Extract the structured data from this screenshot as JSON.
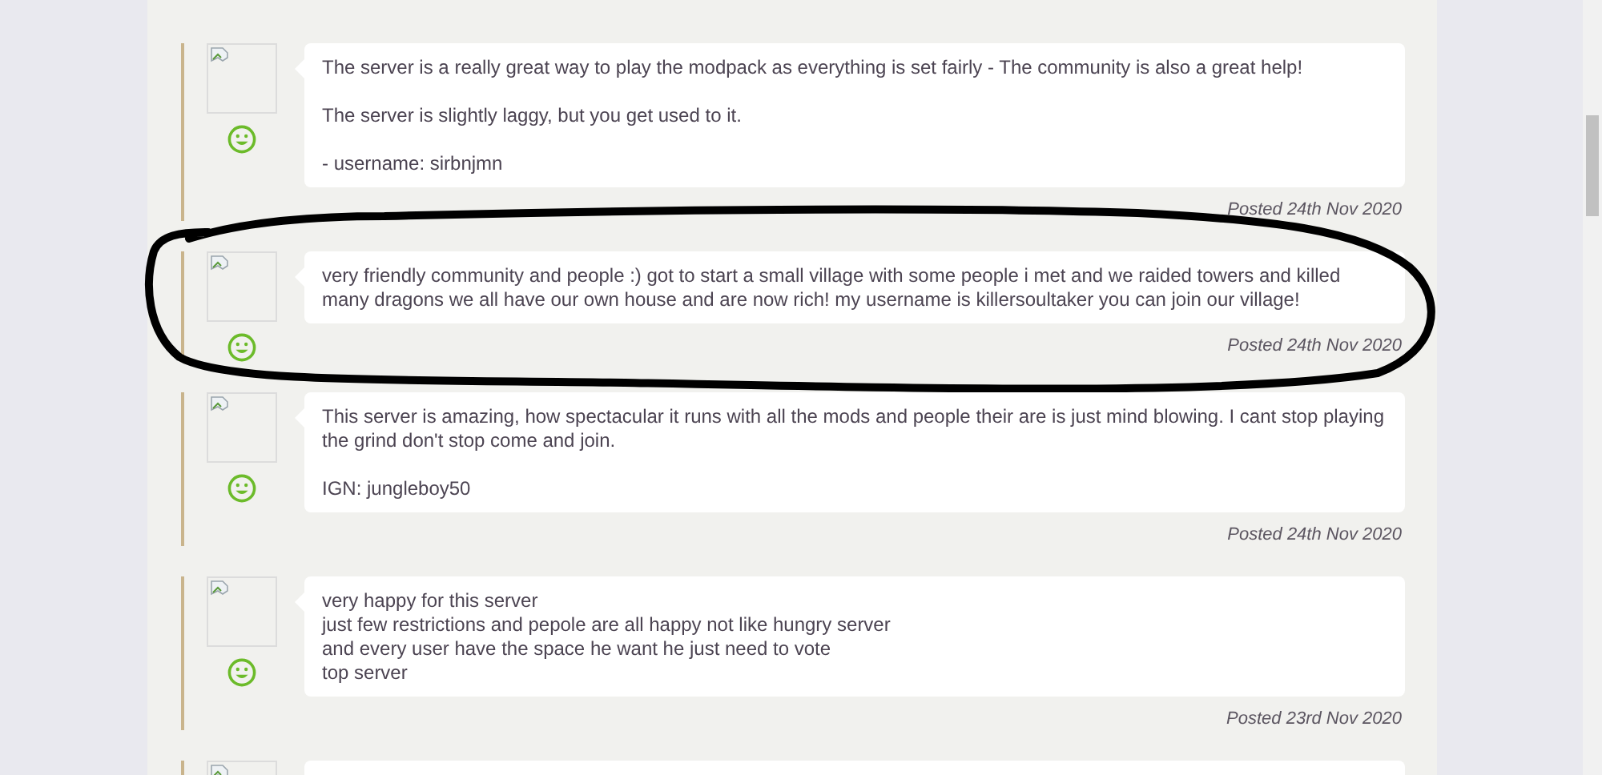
{
  "reviews": [
    {
      "circled": false,
      "paragraphs": [
        [
          "The server is a really great way to play the modpack as everything is set fairly - The community is also a great help!"
        ],
        [
          "The server is slightly laggy, but you get used to it."
        ],
        [
          "- username: sirbnjmn"
        ]
      ],
      "date": "Posted 24th Nov 2020"
    },
    {
      "circled": true,
      "paragraphs": [
        [
          "very friendly community and people :) got to start a small village with some people i met and we raided towers and killed many dragons we all have our own house and are now rich! my username is killersoultaker you can join our village!"
        ]
      ],
      "date": "Posted 24th Nov 2020"
    },
    {
      "circled": false,
      "paragraphs": [
        [
          "This server is amazing, how spectacular it runs with all the mods and people their are is just mind blowing. I cant stop playing the grind don't stop come and join."
        ],
        [
          "IGN: jungleboy50"
        ]
      ],
      "date": "Posted 24th Nov 2020"
    },
    {
      "circled": false,
      "paragraphs": [
        [
          "very happy for this server",
          "just few restrictions and pepole are all happy not like hungry server",
          "and every user have the space he want he just need to vote",
          "top server"
        ]
      ],
      "date": "Posted 23rd Nov 2020"
    },
    {
      "circled": false
    }
  ]
}
